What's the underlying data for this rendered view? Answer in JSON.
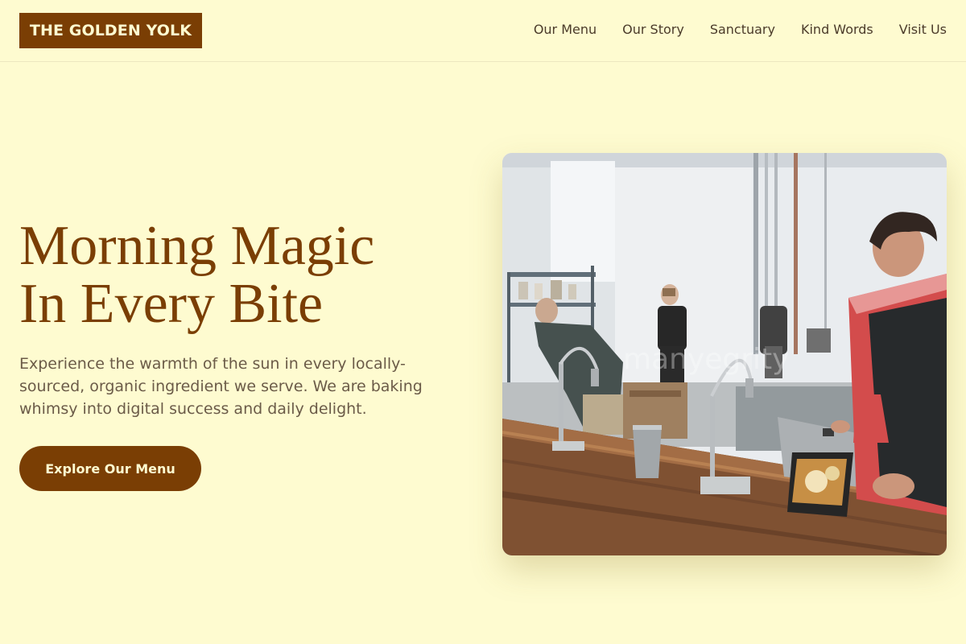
{
  "brand": {
    "name": "THE GOLDEN YOLK"
  },
  "nav": {
    "items": [
      {
        "label": "Our Menu"
      },
      {
        "label": "Our Story"
      },
      {
        "label": "Sanctuary"
      },
      {
        "label": "Kind Words"
      },
      {
        "label": "Visit Us"
      }
    ]
  },
  "hero": {
    "title_line1": "Morning Magic",
    "title_line2": "In Every Bite",
    "description": "Experience the warmth of the sun in every locally-sourced, organic ingredient we serve. We are baking whimsy into digital success and daily delight.",
    "cta_label": "Explore Our Menu",
    "photo_watermark": "manyegrity"
  },
  "colors": {
    "background": "#fefbd0",
    "accent": "#7a3e04",
    "text": "#4b3b2a",
    "muted_text": "#6b5b48"
  }
}
